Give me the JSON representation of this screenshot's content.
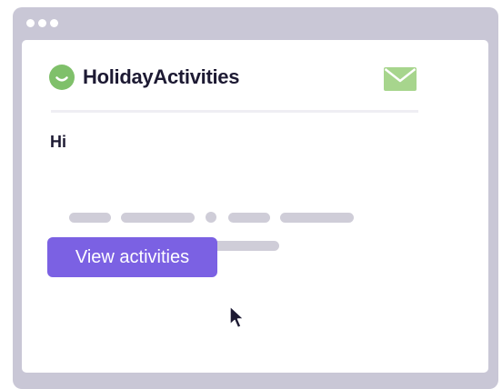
{
  "window": {
    "controls": [
      "dot",
      "dot",
      "dot"
    ]
  },
  "email": {
    "brand": {
      "name": "HolidayActivities",
      "logo_icon": "smiley-circle-icon",
      "logo_color": "#7fc06a"
    },
    "mail_icon": "envelope-icon",
    "mail_icon_color": "#a7d58d",
    "greeting": "Hi",
    "button": {
      "label": "View activities",
      "color": "#7b61e3"
    },
    "cursor_icon": "mouse-pointer-icon"
  },
  "colors": {
    "frame": "#c9c7d6",
    "placeholder_text": "#cfcdd8",
    "text_dark": "#1d1a33"
  }
}
